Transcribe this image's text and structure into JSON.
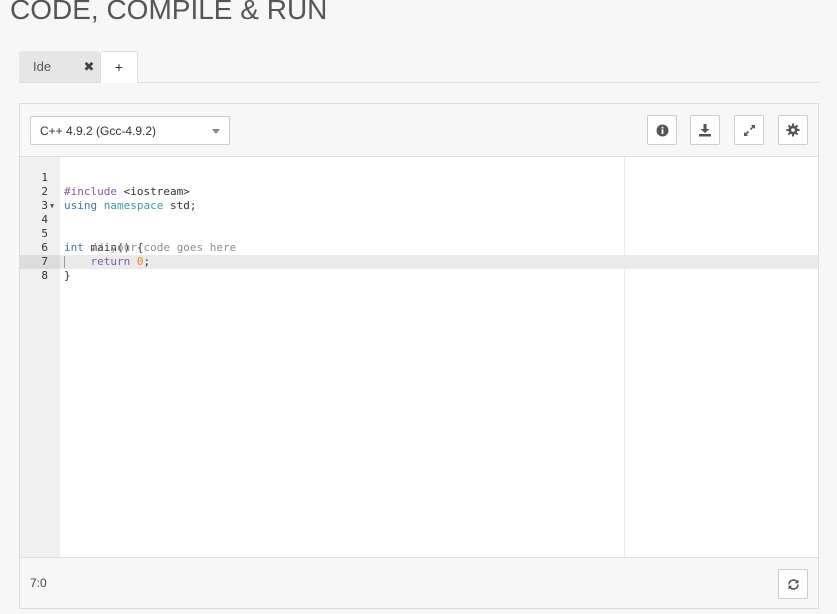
{
  "page": {
    "title": "CODE, COMPILE & RUN"
  },
  "tabs": [
    {
      "label": "Ide",
      "close_icon": "✖"
    },
    {
      "label": "+"
    }
  ],
  "toolbar": {
    "language": "C++ 4.9.2 (Gcc-4.9.2)",
    "buttons": [
      "info-icon",
      "download-icon",
      "expand-icon",
      "settings-icon"
    ]
  },
  "editor": {
    "line_numbers": [
      "1",
      "2",
      "3",
      "4",
      "5",
      "6",
      "7",
      "8"
    ],
    "code": {
      "l1_kw": "#include",
      "l1_rest": " <iostream>",
      "l2_using": "using",
      "l2_namespace": "namespace",
      "l2_rest": " std;",
      "l4_int": "int",
      "l4_rest": " main() {",
      "l5_comment": "    // your code goes here",
      "l6_return": "    return",
      "l6_num": "0",
      "l6_end": ";",
      "l7": "}"
    }
  },
  "status": {
    "cursor_position": "7:0",
    "refresh_icon": "refresh-icon"
  }
}
